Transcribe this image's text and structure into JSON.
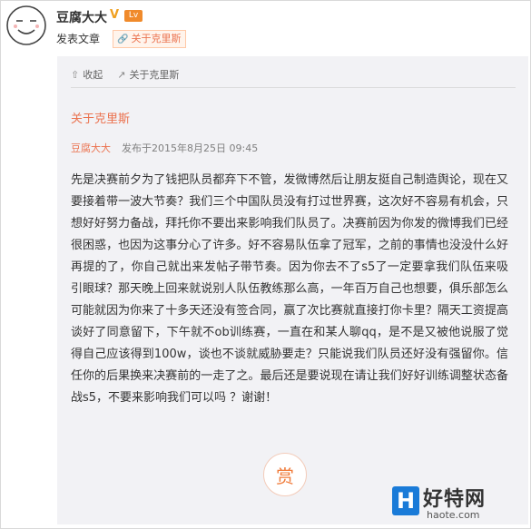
{
  "header": {
    "username": "豆腐大大",
    "verified": "V",
    "level": "Lv",
    "action": "发表文章",
    "article_chip": "关于克里斯"
  },
  "card": {
    "actions": [
      {
        "label": "收起",
        "icon": "collapse-icon"
      },
      {
        "label": "关于克里斯",
        "icon": "external-link-icon"
      }
    ],
    "article": {
      "title": "关于克里斯",
      "author": "豆腐大大",
      "published": "发布于2015年8月25日 09:45",
      "body": "先是决赛前夕为了钱把队员都弃下不管，发微博然后让朋友挺自己制造舆论，现在又要接着带一波大节奏？我们三个中国队员没有打过世界赛，这次好不容易有机会，只想好好努力备战，拜托你不要出来影响我们队员了。决赛前因为你发的微博我们已经很困惑，也因为这事分心了许多。好不容易队伍拿了冠军，之前的事情也没没什么好再提的了，你自己就出来发帖子带节奏。因为你去不了s5了一定要拿我们队伍来吸引眼球？那天晚上回来就说别人队伍教练那么高，一年百万自己也想要，俱乐部怎么可能就因为你来了十多天还没有签合同，赢了次比赛就直接打你卡里？隔天工资提高谈好了同意留下，下午就不ob训练赛，一直在和某人聊qq，是不是又被他说服了觉得自己应该得到100w，谈也不谈就威胁要走？只能说我们队员还好没有强留你。信任你的后果换来决赛前的一走了之。最后还是要说现在请让我们好好训练调整状态备战s5，不要来影响我们可以吗 ？谢谢！"
    },
    "reward": "赏"
  },
  "watermark": {
    "logo_letter": "H",
    "brand": "好特网",
    "url": "haote.com"
  }
}
